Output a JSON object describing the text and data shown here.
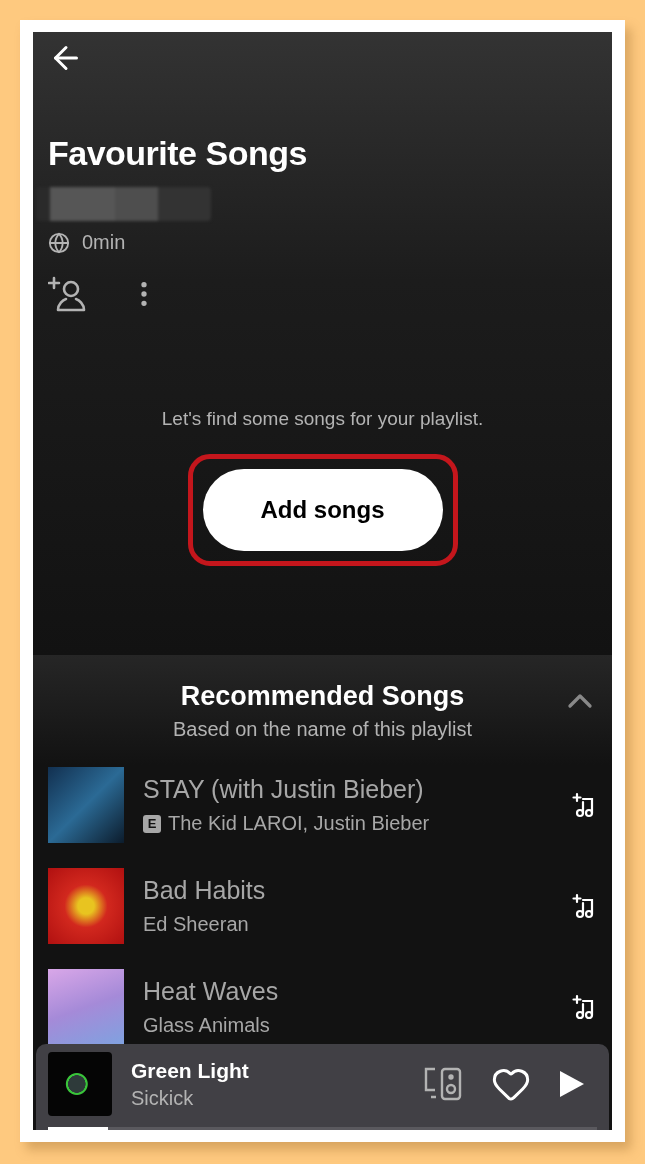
{
  "header": {
    "title": "Favourite Songs",
    "duration": "0min"
  },
  "empty_state": {
    "message": "Let's find some songs for your playlist.",
    "button": {
      "label": "Add songs",
      "highlighted": true
    }
  },
  "recommended": {
    "title": "Recommended Songs",
    "subtitle": "Based on the name of this playlist",
    "expanded": true,
    "songs": [
      {
        "title": "STAY (with Justin Bieber)",
        "artist": "The Kid LAROI, Justin Bieber",
        "badge": "E"
      },
      {
        "title": "Bad Habits",
        "artist": "Ed Sheeran"
      },
      {
        "title": "Heat Waves",
        "artist": "Glass Animals"
      }
    ]
  },
  "now_playing": {
    "title": "Green Light",
    "artist": "Sickick",
    "liked": false,
    "level": 0.11
  }
}
